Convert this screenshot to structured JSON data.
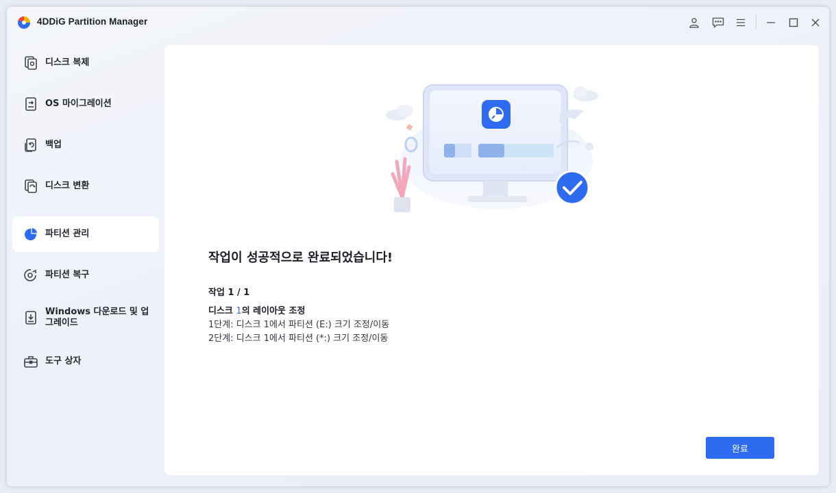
{
  "app": {
    "title": "4DDiG Partition Manager"
  },
  "titlebar": {
    "icons": [
      "account-icon",
      "feedback-icon",
      "menu-icon",
      "minimize-icon",
      "maximize-icon",
      "close-icon"
    ]
  },
  "sidebar": {
    "items": [
      {
        "label": "디스크 복제",
        "icon": "disk-clone-icon",
        "active": false
      },
      {
        "label": "OS 마이그레이션",
        "icon": "os-migration-icon",
        "active": false
      },
      {
        "label": "백업",
        "icon": "backup-icon",
        "active": false
      },
      {
        "label": "디스크 변환",
        "icon": "disk-convert-icon",
        "active": false
      },
      {
        "label": "파티션 관리",
        "icon": "partition-manage-icon",
        "active": true
      },
      {
        "label": "파티션 복구",
        "icon": "partition-recovery-icon",
        "active": false
      },
      {
        "label": "Windows 다운로드 및 업그레이드",
        "icon": "windows-download-icon",
        "active": false
      },
      {
        "label": "도구 상자",
        "icon": "toolbox-icon",
        "active": false
      }
    ]
  },
  "main": {
    "success_title": "작업이 성공적으로 완료되었습니다!",
    "operation_count": "작업 1 / 1",
    "operation_title_prefix": "디스크 ",
    "operation_title_disk": "1",
    "operation_title_suffix": "의 레이아웃 조정",
    "steps": [
      "1단계: 디스크 1에서 파티션 (E:) 크기 조정/이동",
      "2단계: 디스크 1에서 파티션 (*:) 크기 조정/이동"
    ],
    "done_button": "완료"
  },
  "colors": {
    "accent": "#2f6bf0",
    "highlight": "#3a6bd9",
    "sidebar_active_bg": "#ffffff"
  }
}
